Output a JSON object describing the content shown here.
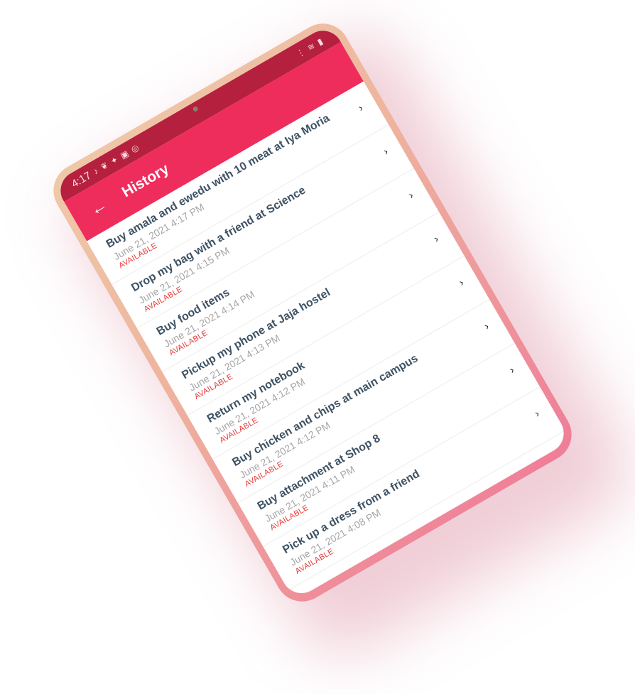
{
  "status_bar": {
    "time": "4:17",
    "left_icons": [
      "music-note-icon",
      "bird-icon",
      "twitter-icon",
      "linkedin-icon",
      "search-app-icon"
    ],
    "right_icons": [
      "signal-icon",
      "wifi-icon",
      "battery-icon"
    ]
  },
  "app_bar": {
    "back_icon": "←",
    "title": "History"
  },
  "colors": {
    "status_bar": "#b5203f",
    "app_bar": "#ef2d5c",
    "title_text": "#3e5264",
    "date_text": "#a6a6a6",
    "status_text": "#e53935"
  },
  "history": {
    "items": [
      {
        "title": "Buy amala and ewedu with 10 meat at Iya Moria",
        "date": "June 21, 2021 4:17 PM",
        "status": "AVAILABLE"
      },
      {
        "title": "Drop my bag with a friend at Science",
        "date": "June 21, 2021 4:15 PM",
        "status": "AVAILABLE"
      },
      {
        "title": "Buy food items",
        "date": "June 21, 2021 4:14 PM",
        "status": "AVAILABLE"
      },
      {
        "title": "Pickup my phone at Jaja hostel",
        "date": "June 21, 2021 4:13 PM",
        "status": "AVAILABLE"
      },
      {
        "title": "Return my notebook",
        "date": "June 21, 2021 4:12 PM",
        "status": "AVAILABLE"
      },
      {
        "title": "Buy chicken and chips at main campus",
        "date": "June 21, 2021 4:12 PM",
        "status": "AVAILABLE"
      },
      {
        "title": "Buy attachment at Shop 8",
        "date": "June 21, 2021 4:11 PM",
        "status": "AVAILABLE"
      },
      {
        "title": "Pick up a dress from a friend",
        "date": "June 21, 2021 4:08 PM",
        "status": "AVAILABLE"
      }
    ]
  }
}
